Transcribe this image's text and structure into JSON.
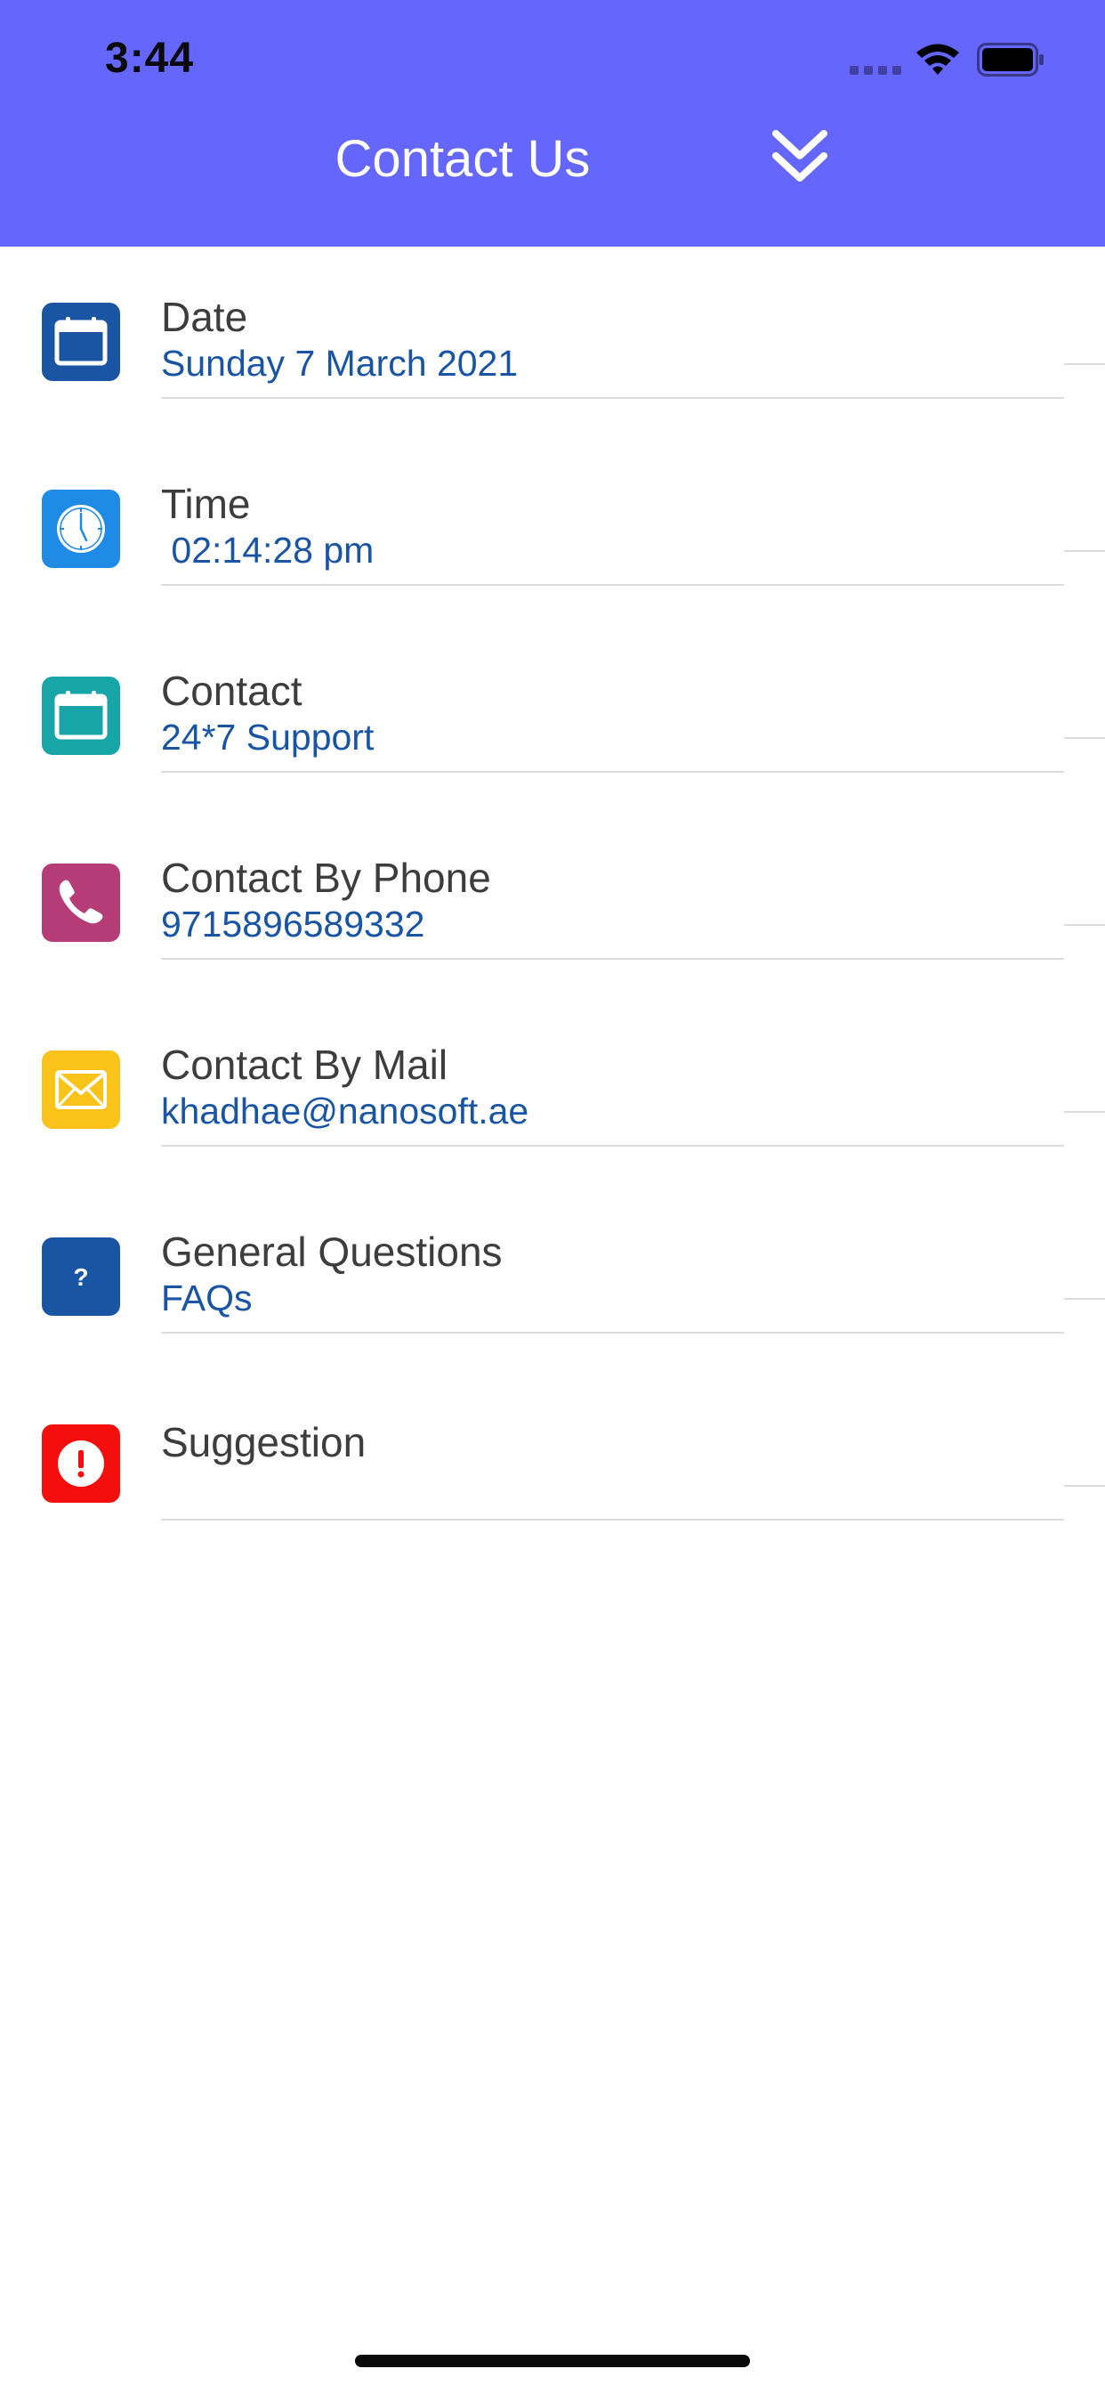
{
  "status_bar": {
    "time": "3:44"
  },
  "header": {
    "title": "Contact Us",
    "background_color": "#6466fc",
    "collapse_icon": "double-chevron-down-icon"
  },
  "items": [
    {
      "title": "Date",
      "subtitle": "Sunday 7 March 2021",
      "icon": "calendar-icon",
      "icon_color": "#1a55a4"
    },
    {
      "title": "Time",
      "subtitle": " 02:14:28 pm",
      "icon": "clock-icon",
      "icon_color": "#1f8be6"
    },
    {
      "title": "Contact",
      "subtitle": "24*7 Support",
      "icon": "calendar-icon",
      "icon_color": "#17a5a8"
    },
    {
      "title": "Contact By Phone",
      "subtitle": "9715896589332",
      "icon": "phone-icon",
      "icon_color": "#b63c78"
    },
    {
      "title": "Contact By Mail",
      "subtitle": "khadhae@nanosoft.ae",
      "icon": "mail-icon",
      "icon_color": "#f9c31a"
    },
    {
      "title": "General Questions",
      "subtitle": "FAQs",
      "icon": "question-icon",
      "icon_color": "#1a55a4"
    },
    {
      "title": "Suggestion",
      "subtitle": "",
      "icon": "alert-icon",
      "icon_color": "#f50e0e"
    }
  ],
  "colors": {
    "title_text": "#3d3d3d",
    "subtitle_text": "#1a55a4",
    "divider": "#dcdcdc"
  }
}
